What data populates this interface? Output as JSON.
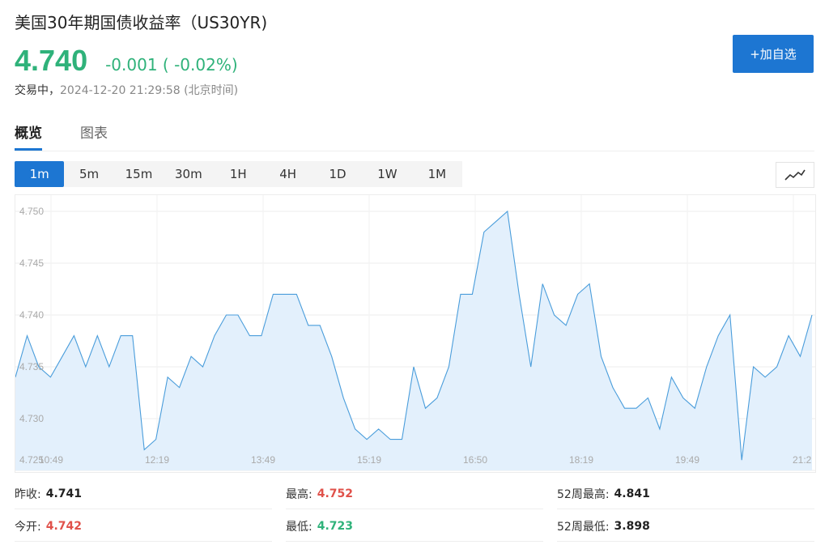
{
  "header": {
    "title": "美国30年期国债收益率（US30YR)",
    "price": "4.740",
    "change": "-0.001 ( -0.02%)",
    "status_label": "交易中，",
    "timestamp": "2024-12-20 21:29:58 (北京时间)",
    "add_button": "+加自选"
  },
  "tabs": [
    {
      "label": "概览"
    },
    {
      "label": "图表"
    }
  ],
  "timeframes": [
    {
      "label": "1m"
    },
    {
      "label": "5m"
    },
    {
      "label": "15m"
    },
    {
      "label": "30m"
    },
    {
      "label": "1H"
    },
    {
      "label": "4H"
    },
    {
      "label": "1D"
    },
    {
      "label": "1W"
    },
    {
      "label": "1M"
    }
  ],
  "colors": {
    "accent": "#1d76d2",
    "up": "#e0514a",
    "down": "#2fb27a",
    "line": "#4a9ddb",
    "fill": "#e3f0fc"
  },
  "icons": {
    "chart_type": "line-chart-icon"
  },
  "chart_data": {
    "type": "area",
    "ylim": [
      4.725,
      4.75
    ],
    "y_ticks": [
      "4.750",
      "4.745",
      "4.740",
      "4.735",
      "4.730",
      "4.725"
    ],
    "x_ticks": [
      "10:49",
      "12:19",
      "13:49",
      "15:19",
      "16:50",
      "18:19",
      "19:49",
      "21:2"
    ],
    "values": [
      4.734,
      4.738,
      4.735,
      4.734,
      4.736,
      4.738,
      4.735,
      4.738,
      4.735,
      4.738,
      4.738,
      4.727,
      4.728,
      4.734,
      4.733,
      4.736,
      4.735,
      4.738,
      4.74,
      4.74,
      4.738,
      4.738,
      4.742,
      4.742,
      4.742,
      4.739,
      4.739,
      4.736,
      4.732,
      4.729,
      4.728,
      4.729,
      4.728,
      4.728,
      4.735,
      4.731,
      4.732,
      4.735,
      4.742,
      4.742,
      4.748,
      4.749,
      4.75,
      4.742,
      4.735,
      4.743,
      4.74,
      4.739,
      4.742,
      4.743,
      4.736,
      4.733,
      4.731,
      4.731,
      4.732,
      4.729,
      4.734,
      4.732,
      4.731,
      4.735,
      4.738,
      4.74,
      4.726,
      4.735,
      4.734,
      4.735,
      4.738,
      4.736,
      4.74
    ]
  },
  "stats": [
    {
      "label": "昨收:",
      "value": "4.741",
      "tone": "neutral"
    },
    {
      "label": "最高:",
      "value": "4.752",
      "tone": "red"
    },
    {
      "label": "52周最高:",
      "value": "4.841",
      "tone": "neutral"
    },
    {
      "label": "今开:",
      "value": "4.742",
      "tone": "red"
    },
    {
      "label": "最低:",
      "value": "4.723",
      "tone": "green"
    },
    {
      "label": "52周最低:",
      "value": "3.898",
      "tone": "neutral"
    }
  ]
}
